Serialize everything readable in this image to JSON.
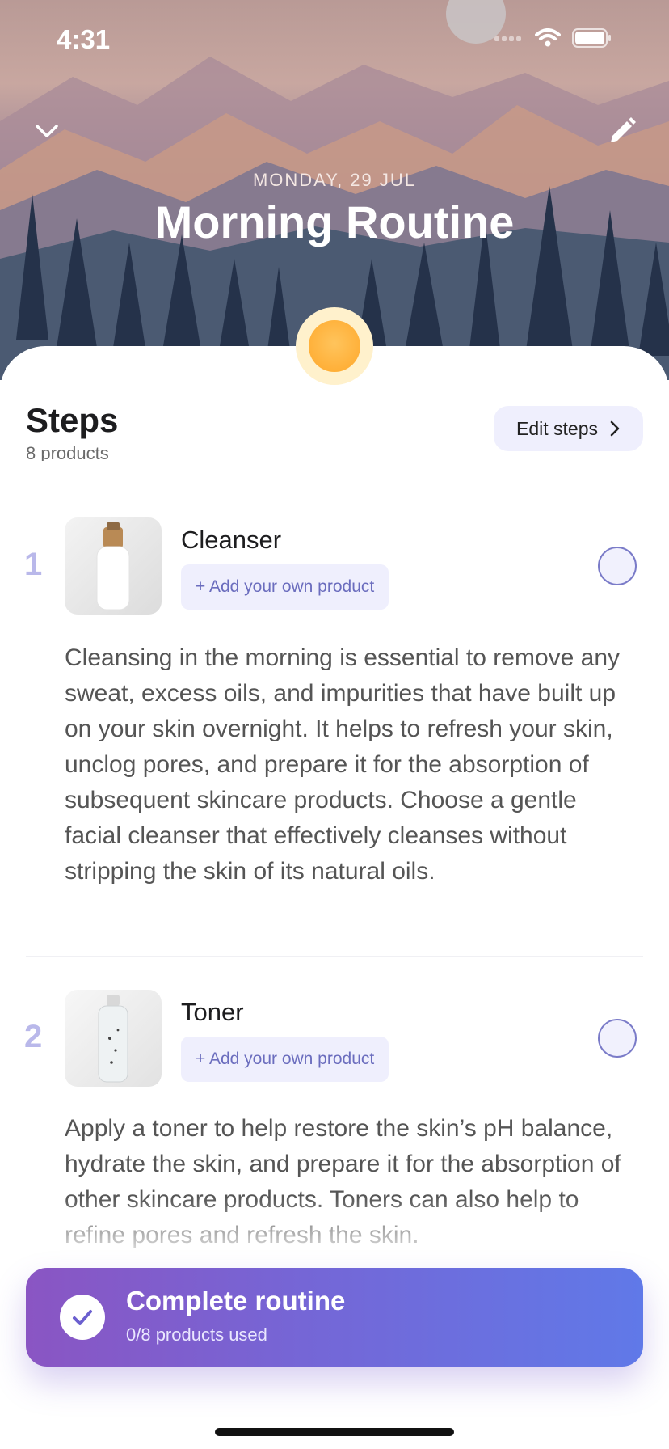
{
  "status_bar": {
    "time": "4:31"
  },
  "header": {
    "date": "MONDAY, 29 JUL",
    "title": "Morning Routine"
  },
  "steps_section": {
    "title": "Steps",
    "subtitle": "8 products",
    "edit_label": "Edit steps"
  },
  "steps": [
    {
      "number": "1",
      "product": "Cleanser",
      "add_label": "+ Add your own product",
      "description": "Cleansing in the morning is essential to remove any sweat, excess oils, and impurities that have built up on your skin overnight. It helps to refresh your skin, unclog pores, and prepare it for the absorption of subsequent skincare products. Choose a gentle facial cleanser that effectively cleanses without stripping the skin of its natural oils."
    },
    {
      "number": "2",
      "product": "Toner",
      "add_label": "+ Add your own product",
      "description": "Apply a toner to help restore the skin’s pH balance, hydrate the skin, and prepare it for the absorption of other skincare products. Toners can also help to refine pores and refresh the skin."
    }
  ],
  "cta": {
    "title": "Complete routine",
    "subtitle": "0/8 products used"
  },
  "colors": {
    "accent": "#6b6dbe",
    "cta_start": "#8a55c3",
    "cta_end": "#6079e8",
    "sun": "#ffb039"
  },
  "icons": [
    "chevron-down-icon",
    "pencil-icon",
    "chevron-right-icon",
    "checkmark-icon",
    "wifi-icon",
    "battery-icon",
    "signal-icon"
  ]
}
